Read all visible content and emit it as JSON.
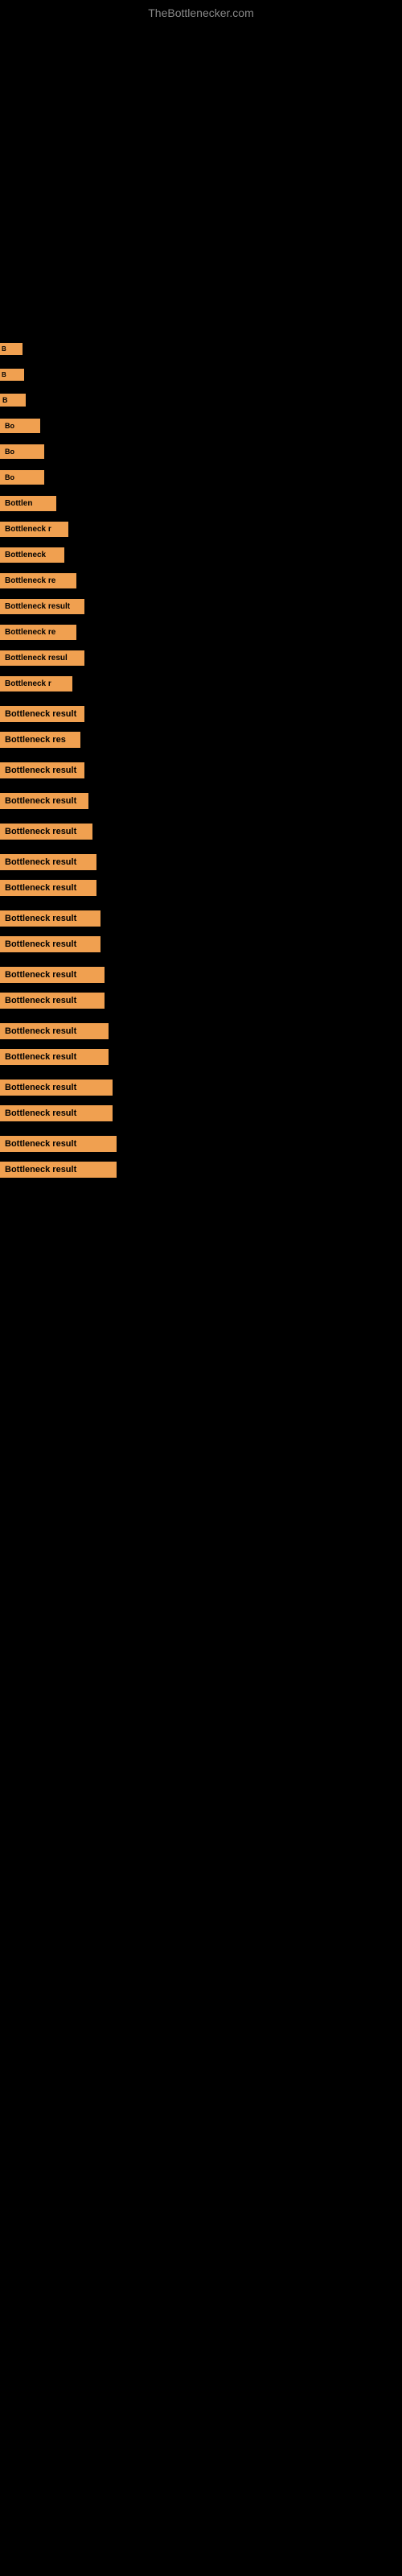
{
  "site": {
    "title": "TheBottlenecker.com"
  },
  "rows": [
    {
      "label": "B",
      "show_spacer": false
    },
    {
      "label": "B",
      "show_spacer": false
    },
    {
      "label": "B",
      "show_spacer": false
    },
    {
      "label": "Bo",
      "show_spacer": false
    },
    {
      "label": "Bo",
      "show_spacer": false
    },
    {
      "label": "Bo",
      "show_spacer": false
    },
    {
      "label": "Bottlen",
      "show_spacer": false
    },
    {
      "label": "Bottleneck r",
      "show_spacer": false
    },
    {
      "label": "Bottleneck",
      "show_spacer": false
    },
    {
      "label": "Bottleneck re",
      "show_spacer": false
    },
    {
      "label": "Bottleneck result",
      "show_spacer": false
    },
    {
      "label": "Bottleneck re",
      "show_spacer": false
    },
    {
      "label": "Bottleneck resul",
      "show_spacer": false
    },
    {
      "label": "Bottleneck r",
      "show_spacer": false
    },
    {
      "label": "Bottleneck result",
      "show_spacer": true
    },
    {
      "label": "Bottleneck res",
      "show_spacer": false
    },
    {
      "label": "Bottleneck result",
      "show_spacer": true
    },
    {
      "label": "Bottleneck result",
      "show_spacer": true
    },
    {
      "label": "Bottleneck result",
      "show_spacer": true
    },
    {
      "label": "Bottleneck result",
      "show_spacer": true
    },
    {
      "label": "Bottleneck result",
      "show_spacer": false
    },
    {
      "label": "Bottleneck result",
      "show_spacer": true
    },
    {
      "label": "Bottleneck result",
      "show_spacer": false
    },
    {
      "label": "Bottleneck result",
      "show_spacer": true
    },
    {
      "label": "Bottleneck result",
      "show_spacer": false
    },
    {
      "label": "Bottleneck result",
      "show_spacer": true
    },
    {
      "label": "Bottleneck result",
      "show_spacer": false
    },
    {
      "label": "Bottleneck result",
      "show_spacer": true
    },
    {
      "label": "Bottleneck result",
      "show_spacer": false
    },
    {
      "label": "Bottleneck result",
      "show_spacer": true
    },
    {
      "label": "Bottleneck result",
      "show_spacer": false
    }
  ]
}
